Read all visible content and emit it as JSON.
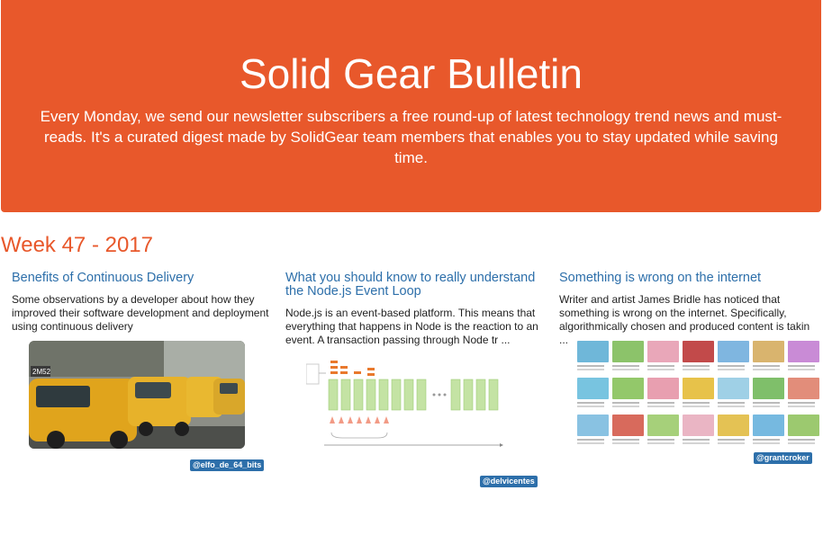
{
  "header": {
    "title": "Solid Gear Bulletin",
    "intro": "Every Monday, we send our newsletter subscribers a free round-up of latest technology trend news and must-reads. It's a curated digest made by SolidGear team members that enables you to stay updated while saving time."
  },
  "week": {
    "title": "Week 47 - 2017"
  },
  "articles": [
    {
      "title": "Benefits of Continuous Delivery",
      "description": "Some observations by a developer about how they improved their software development and deployment using continuous delivery",
      "author": "@elfo_de_64_bits"
    },
    {
      "title": "What you should know to really understand the Node.js Event Loop",
      "description": "Node.js is an event-based platform. This means that everything that happens in Node is the reaction to an event. A transaction passing through Node tr ...",
      "author": "@delvicentes"
    },
    {
      "title": "Something is wrong on the internet",
      "description": "Writer and artist James Bridle has noticed that something is wrong on the internet. Specifically, algorithmically chosen and produced content is takin ...",
      "author": "@grantcroker"
    }
  ],
  "colors": {
    "brand": "#e8582b",
    "link": "#2d6faa",
    "badge": "#2d6faa"
  }
}
